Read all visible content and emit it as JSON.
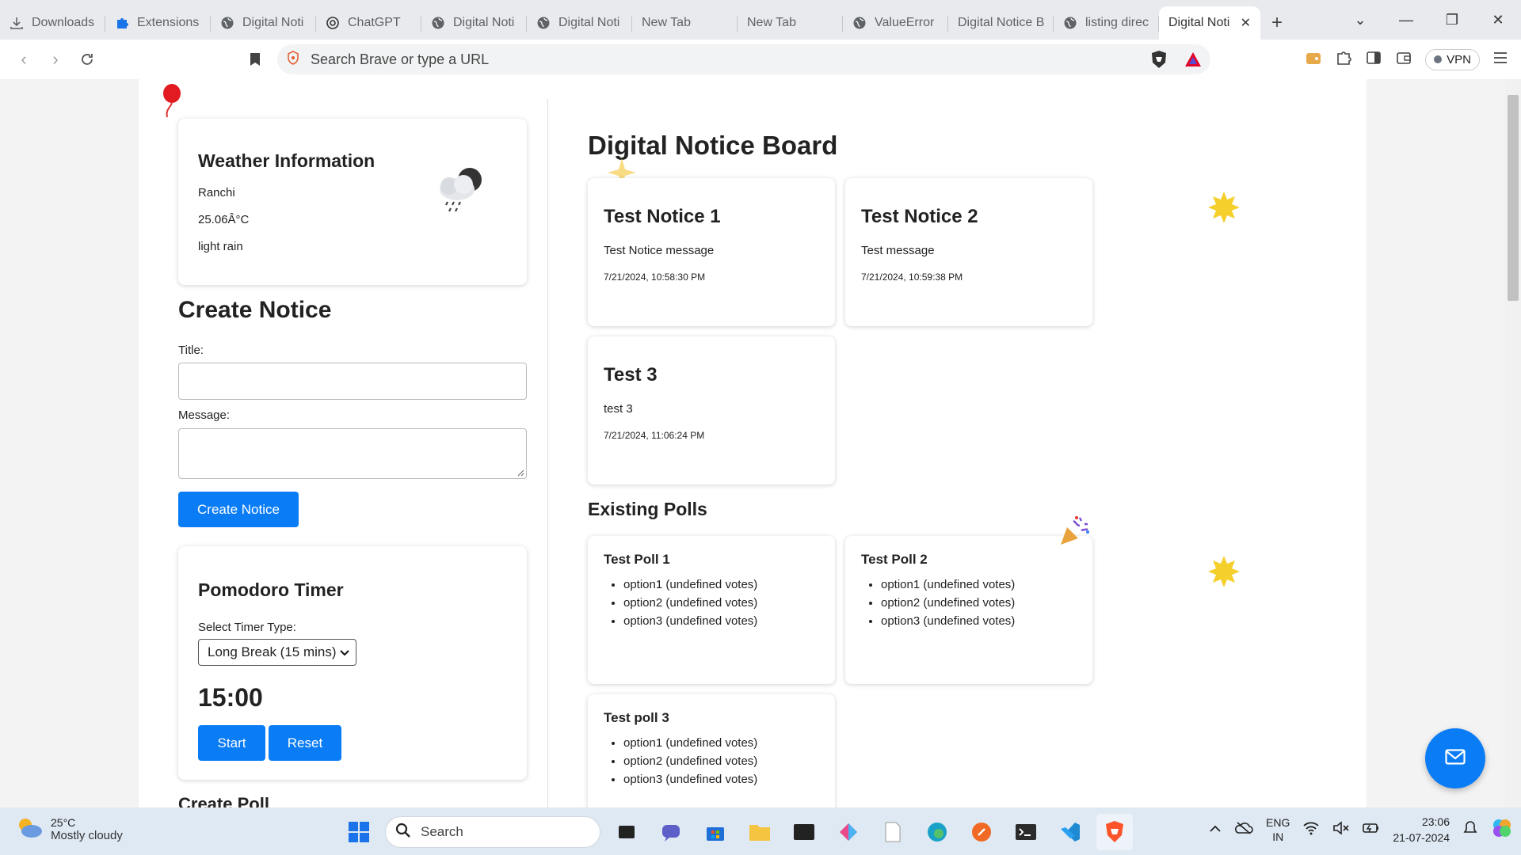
{
  "browser": {
    "tabs": [
      {
        "title": "Downloads",
        "icon": "download-icon"
      },
      {
        "title": "Extensions",
        "icon": "puzzle-icon"
      },
      {
        "title": "Digital Noti",
        "icon": "globe-icon"
      },
      {
        "title": "ChatGPT",
        "icon": "chatgpt-icon"
      },
      {
        "title": "Digital Noti",
        "icon": "globe-icon"
      },
      {
        "title": "Digital Noti",
        "icon": "globe-icon"
      },
      {
        "title": "New Tab",
        "icon": ""
      },
      {
        "title": "New Tab",
        "icon": ""
      },
      {
        "title": "ValueError",
        "icon": "globe-icon"
      },
      {
        "title": "Digital Notice B",
        "icon": ""
      },
      {
        "title": "listing direc",
        "icon": "globe-icon"
      }
    ],
    "active_tab": {
      "title": "Digital Noti"
    },
    "address_placeholder": "Search Brave or type a URL",
    "vpn_label": "VPN"
  },
  "weather": {
    "heading": "Weather Information",
    "city": "Ranchi",
    "temperature": "25.06Â°C",
    "description": "light rain"
  },
  "create_notice": {
    "heading": "Create Notice",
    "title_label": "Title:",
    "message_label": "Message:",
    "submit_label": "Create Notice"
  },
  "pomodoro": {
    "heading": "Pomodoro Timer",
    "select_label": "Select Timer Type:",
    "selected_type": "Long Break (15 mins)",
    "time": "15:00",
    "start_label": "Start",
    "reset_label": "Reset"
  },
  "create_poll": {
    "heading": "Create Poll"
  },
  "board": {
    "heading": "Digital Notice Board",
    "notices": [
      {
        "title": "Test Notice 1",
        "message": "Test Notice message",
        "timestamp": "7/21/2024, 10:58:30 PM"
      },
      {
        "title": "Test Notice 2",
        "message": "Test message",
        "timestamp": "7/21/2024, 10:59:38 PM"
      },
      {
        "title": "Test 3",
        "message": "test 3",
        "timestamp": "7/21/2024, 11:06:24 PM"
      }
    ],
    "polls_heading": "Existing Polls",
    "polls": [
      {
        "title": "Test Poll 1",
        "options": [
          "option1 (undefined votes)",
          "option2 (undefined votes)",
          "option3 (undefined votes)"
        ]
      },
      {
        "title": "Test Poll 2",
        "options": [
          "option1 (undefined votes)",
          "option2 (undefined votes)",
          "option3 (undefined votes)"
        ]
      },
      {
        "title": "Test poll 3",
        "options": [
          "option1 (undefined votes)",
          "option2 (undefined votes)",
          "option3 (undefined votes)"
        ]
      }
    ]
  },
  "taskbar": {
    "weather_temp": "25°C",
    "weather_desc": "Mostly cloudy",
    "search_label": "Search",
    "lang_1": "ENG",
    "lang_2": "IN",
    "time": "23:06",
    "date": "21-07-2024"
  },
  "colors": {
    "accent": "#0a7cf5"
  }
}
